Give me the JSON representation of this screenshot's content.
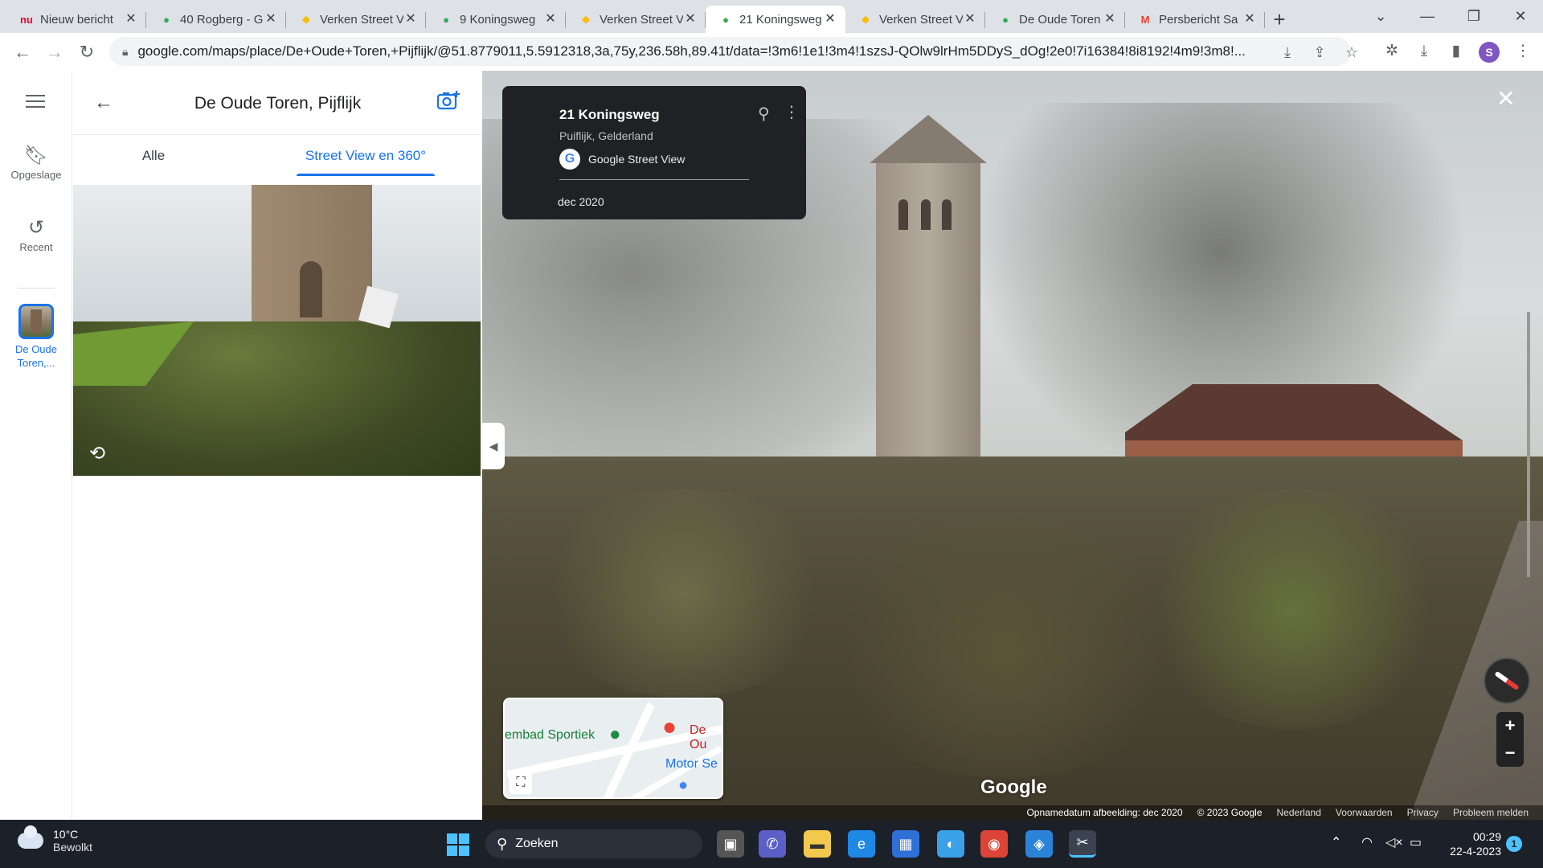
{
  "browser": {
    "tabs": [
      {
        "title": "Nieuw bericht",
        "favicon": "nu-nl-icon",
        "fav_glyph": "nu",
        "fav_color": "#e4032e",
        "active": false
      },
      {
        "title": "40 Rogberg - G",
        "favicon": "maps-pin-icon",
        "fav_glyph": "●",
        "fav_color": "#34a853",
        "active": false
      },
      {
        "title": "Verken Street V",
        "favicon": "maps-icon",
        "fav_glyph": "◆",
        "fav_color": "#fbbc04",
        "active": false
      },
      {
        "title": "9 Koningsweg",
        "favicon": "maps-pin-icon",
        "fav_glyph": "●",
        "fav_color": "#34a853",
        "active": false
      },
      {
        "title": "Verken Street V",
        "favicon": "maps-icon",
        "fav_glyph": "◆",
        "fav_color": "#fbbc04",
        "active": false
      },
      {
        "title": "21 Koningsweg",
        "favicon": "maps-pin-icon",
        "fav_glyph": "●",
        "fav_color": "#34a853",
        "active": true
      },
      {
        "title": "Verken Street V",
        "favicon": "maps-icon",
        "fav_glyph": "◆",
        "fav_color": "#fbbc04",
        "active": false
      },
      {
        "title": "De Oude Toren",
        "favicon": "maps-pin-icon",
        "fav_glyph": "●",
        "fav_color": "#34a853",
        "active": false
      },
      {
        "title": "Persbericht Sa",
        "favicon": "gmail-icon",
        "fav_glyph": "M",
        "fav_color": "#ea4335",
        "active": false
      }
    ],
    "new_tab": "+",
    "url": "google.com/maps/place/De+Oude+Toren,+Pijflijk/@51.8779011,5.5912318,3a,75y,236.58h,89.41t/data=!3m6!1e1!3m4!1szsJ-QOlw9lrHm5DDyS_dOg!2e0!7i16384!8i8192!4m9!3m8!...",
    "profile_initial": "S"
  },
  "maps": {
    "rail": {
      "saved_label": "Opgeslage",
      "recent_label": "Recent",
      "place_label": "De Oude Toren,..."
    },
    "panel": {
      "title": "De Oude Toren, Pijflijk",
      "tabs": [
        {
          "label": "Alle",
          "selected": false
        },
        {
          "label": "Street View en 360°",
          "selected": true
        }
      ]
    },
    "streetview": {
      "address": "21 Koningsweg",
      "locality": "Puiflijk, Gelderland",
      "source": "Google Street View",
      "date": "dec 2020",
      "minimap": {
        "label_left": "embad Sportiek",
        "label_right_top": "De Ou",
        "label_right_bottom": "Motor Se"
      },
      "watermark": "Google",
      "footer": [
        "Opnamedatum afbeelding: dec 2020",
        "© 2023 Google",
        "Nederland",
        "Voorwaarden",
        "Privacy",
        "Probleem melden"
      ]
    }
  },
  "taskbar": {
    "temperature": "10°C",
    "condition": "Bewolkt",
    "search_label": "Zoeken",
    "time": "00:29",
    "date": "22-4-2023",
    "notification_count": "1"
  },
  "colors": {
    "accent": "#1a73e8",
    "card_bg": "#202124",
    "taskbar_bg": "#1c2029"
  }
}
